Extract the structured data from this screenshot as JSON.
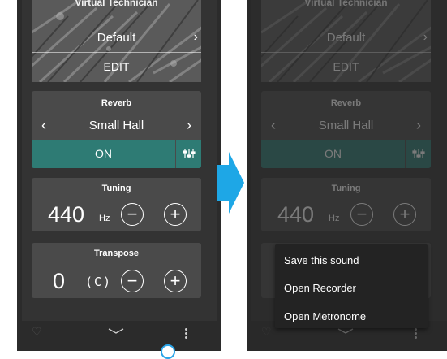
{
  "arrow_color": "#1ea7e6",
  "accent_color": "#2e7b74",
  "hero": {
    "title": "Virtual Technician",
    "preset": "Default",
    "edit": "EDIT"
  },
  "reverb": {
    "title": "Reverb",
    "value": "Small Hall",
    "toggle": "ON"
  },
  "tuning": {
    "title": "Tuning",
    "value": "440",
    "unit": "Hz",
    "minus": "−",
    "plus": "+"
  },
  "transpose": {
    "title": "Transpose",
    "value": "0",
    "note": "(C)",
    "minus": "−",
    "plus": "+"
  },
  "menu": {
    "items": [
      "Save this sound",
      "Open Recorder",
      "Open Metronome"
    ]
  },
  "icons": [
    "heart-icon",
    "chevron-down-icon",
    "more-vertical-icon",
    "sliders-icon",
    "chevron-left-icon",
    "chevron-right-icon"
  ]
}
